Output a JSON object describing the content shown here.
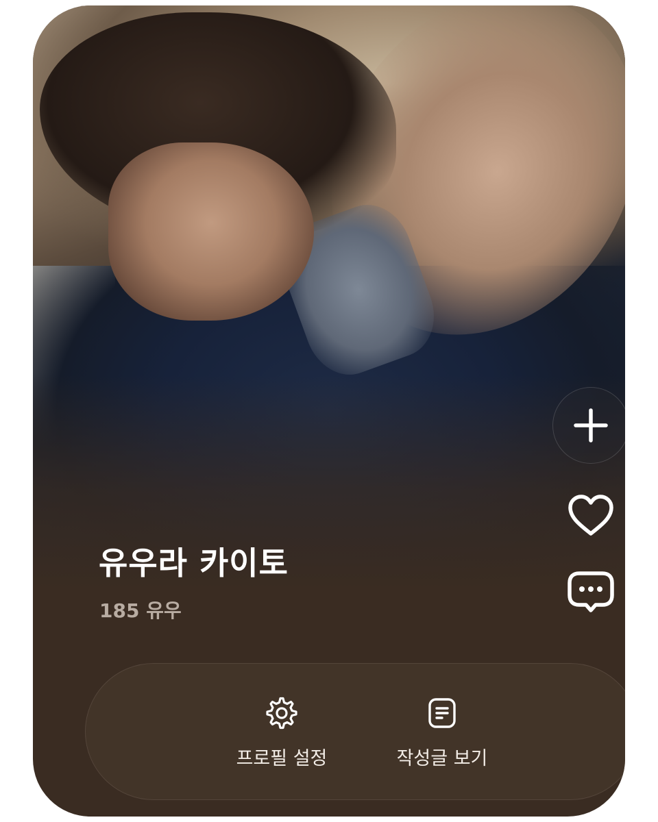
{
  "profile": {
    "name": "유우라 카이토",
    "followers": "185 유우"
  },
  "side_actions": {
    "add_icon": "plus-icon",
    "like_icon": "heart-icon",
    "comment_icon": "chat-bubble-icon"
  },
  "bottom_bar": {
    "profile_settings": {
      "label": "프로필 설정",
      "icon": "gear-icon"
    },
    "view_posts": {
      "label": "작성글 보기",
      "icon": "document-list-icon"
    }
  },
  "colors": {
    "card_background": "#3a2c22",
    "bar_background": "#423428",
    "text_primary": "#ffffff",
    "text_secondary": "#b8aca2"
  }
}
